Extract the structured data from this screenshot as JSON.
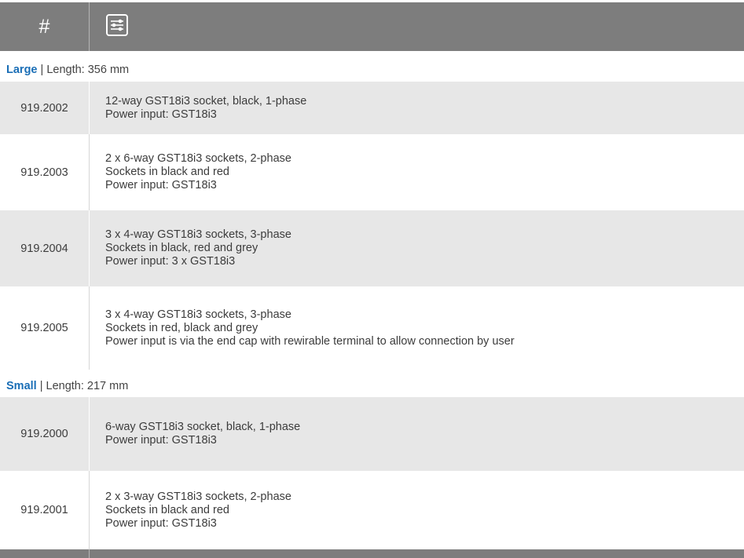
{
  "header": {
    "hash_label": "#",
    "filter_icon": "sliders-icon"
  },
  "sections": [
    {
      "name": "Large",
      "length_label": " | Length: 356 mm",
      "rows": [
        {
          "code": "919.2002",
          "lines": [
            "12-way GST18i3 socket, black, 1-phase",
            "Power input: GST18i3"
          ]
        },
        {
          "code": "919.2003",
          "lines": [
            "2 x 6-way GST18i3 sockets, 2-phase",
            "Sockets in black and red",
            "Power input: GST18i3"
          ]
        },
        {
          "code": "919.2004",
          "lines": [
            "3 x 4-way GST18i3 sockets, 3-phase",
            "Sockets in black, red and grey",
            "Power input: 3 x GST18i3"
          ]
        },
        {
          "code": "919.2005",
          "lines": [
            "3 x 4-way GST18i3 sockets, 3-phase",
            "Sockets in red, black and grey",
            "Power input is via the end cap with rewirable terminal to allow connection by user"
          ]
        }
      ]
    },
    {
      "name": "Small",
      "length_label": " | Length: 217 mm",
      "rows": [
        {
          "code": "919.2000",
          "lines": [
            "6-way GST18i3 socket, black, 1-phase",
            "Power input: GST18i3"
          ]
        },
        {
          "code": "919.2001",
          "lines": [
            "2 x 3-way GST18i3 sockets, 2-phase",
            "Sockets in black and red",
            "Power input: GST18i3"
          ]
        }
      ]
    }
  ]
}
